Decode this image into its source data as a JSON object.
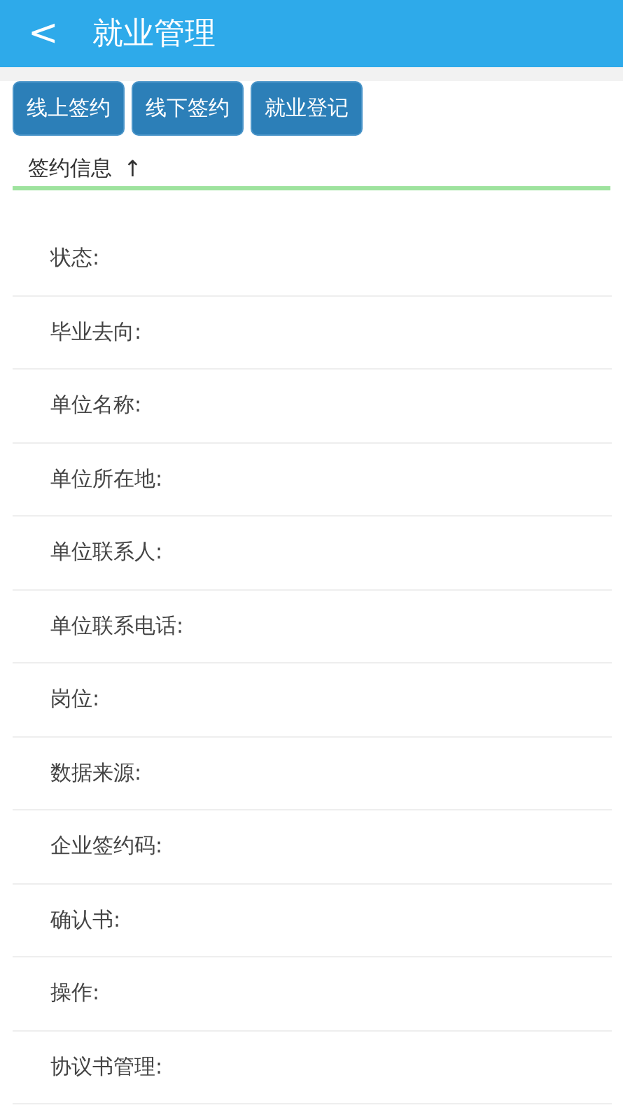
{
  "header": {
    "back": "<",
    "title": "就业管理"
  },
  "buttons": [
    "线上签约",
    "线下签约",
    "就业登记"
  ],
  "section": {
    "title": "签约信息",
    "arrow": "↑"
  },
  "fields": [
    {
      "label": "状态:"
    },
    {
      "label": "毕业去向:"
    },
    {
      "label": "单位名称:"
    },
    {
      "label": "单位所在地:"
    },
    {
      "label": "单位联系人:"
    },
    {
      "label": "单位联系电话:"
    },
    {
      "label": "岗位:"
    },
    {
      "label": "数据来源:"
    },
    {
      "label": "企业签约码:"
    },
    {
      "label": "确认书:"
    },
    {
      "label": "操作:"
    },
    {
      "label": "协议书管理:"
    }
  ]
}
